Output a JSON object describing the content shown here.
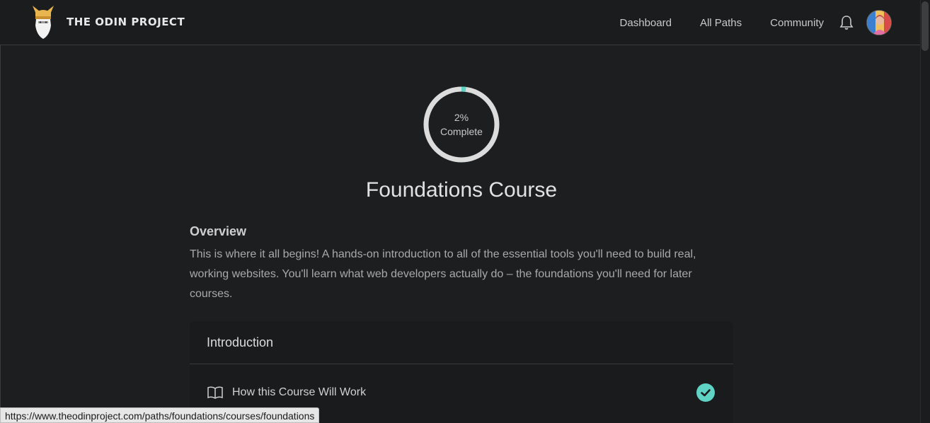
{
  "header": {
    "brand": "THE ODIN PROJECT",
    "nav": [
      "Dashboard",
      "All Paths",
      "Community"
    ]
  },
  "progress": {
    "percent_label": "2%",
    "complete_label": "Complete",
    "value": 0.02
  },
  "course": {
    "title": "Foundations Course",
    "overview_title": "Overview",
    "overview_text": "This is where it all begins! A hands-on introduction to all of the essential tools you'll need to build real, working websites. You'll learn what web developers actually do – the foundations you'll need for later courses."
  },
  "section": {
    "title": "Introduction",
    "lessons": [
      {
        "title": "How this Course Will Work",
        "completed": true
      }
    ]
  },
  "status_bar": {
    "url": "https://www.theodinproject.com/paths/foundations/courses/foundations"
  },
  "colors": {
    "accent": "#5fd4c4",
    "background": "#1d1e20"
  }
}
